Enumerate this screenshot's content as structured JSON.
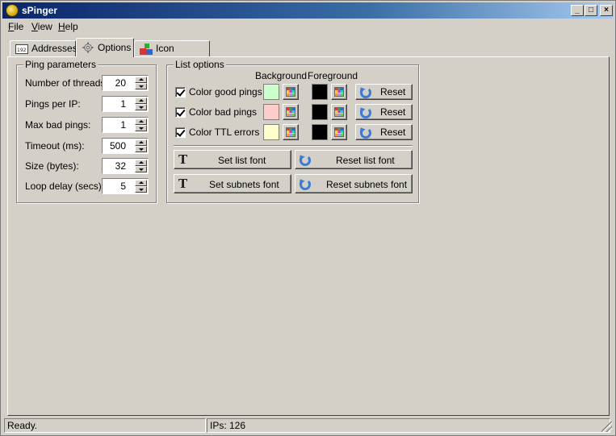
{
  "window": {
    "title": "sPinger",
    "controls": {
      "minimize": "_",
      "maximize": "□",
      "close": "×"
    }
  },
  "menu": [
    {
      "label": "File",
      "accel": "F",
      "rest": "ile"
    },
    {
      "label": "View",
      "accel": "V",
      "rest": "iew"
    },
    {
      "label": "Help",
      "accel": "H",
      "rest": "elp"
    }
  ],
  "tabs": [
    {
      "label": "Addresses",
      "icon": "ip-addresses-icon",
      "active": false
    },
    {
      "label": "Options",
      "icon": "gear-icon",
      "active": true
    },
    {
      "label": "Icon Themes",
      "icon": "shapes-icon",
      "active": false
    }
  ],
  "ping_parameters": {
    "title": "Ping parameters",
    "fields": [
      {
        "label": "Number of threads:",
        "value": "20"
      },
      {
        "label": "Pings per IP:",
        "value": "1"
      },
      {
        "label": "Max bad pings:",
        "value": "1"
      },
      {
        "label": "Timeout (ms):",
        "value": "500"
      },
      {
        "label": "Size (bytes):",
        "value": "32"
      },
      {
        "label": "Loop delay (secs):",
        "value": "5"
      }
    ]
  },
  "list_options": {
    "title": "List options",
    "background_header": "Background",
    "foreground_header": "Foreground",
    "rows": [
      {
        "label": "Color good pings",
        "checked": true,
        "background": "#ccffcc",
        "foreground": "#000000",
        "reset": "Reset"
      },
      {
        "label": "Color bad pings",
        "checked": true,
        "background": "#ffcccc",
        "foreground": "#000000",
        "reset": "Reset"
      },
      {
        "label": "Color TTL errors",
        "checked": true,
        "background": "#ffffcc",
        "foreground": "#000000",
        "reset": "Reset"
      }
    ],
    "set_list_font": "Set list font",
    "reset_list_font": "Reset list font",
    "set_subnets_font": "Set subnets font",
    "reset_subnets_font": "Reset subnets font"
  },
  "status": {
    "left": "Ready.",
    "right": "IPs: 126"
  }
}
